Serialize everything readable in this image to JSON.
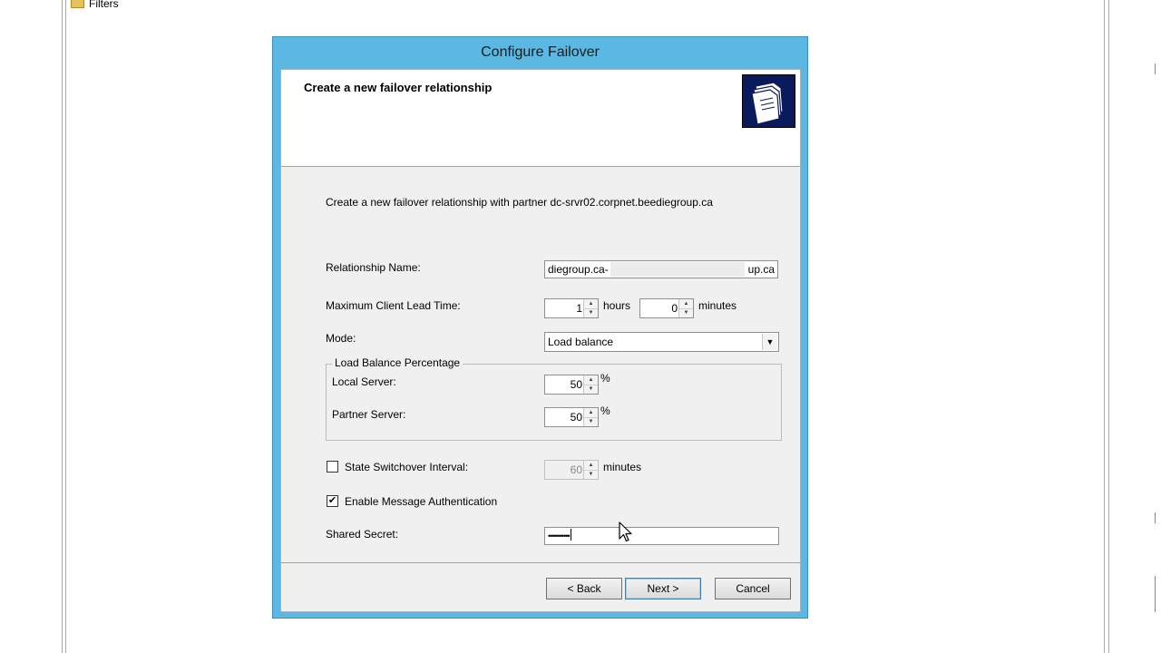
{
  "background": {
    "filters_label": "Filters"
  },
  "dialog": {
    "title": "Configure Failover",
    "header_title": "Create a new failover relationship",
    "intro_text": "Create a new failover relationship with partner dc-srvr02.corpnet.beediegroup.ca",
    "relationship_name": {
      "label": "Relationship Name:",
      "value_left": "diegroup.ca-",
      "value_right": "up.ca"
    },
    "max_client_lead_time": {
      "label": "Maximum Client Lead Time:",
      "hours_value": "1",
      "hours_unit": "hours",
      "minutes_value": "0",
      "minutes_unit": "minutes"
    },
    "mode": {
      "label": "Mode:",
      "selected": "Load balance"
    },
    "load_balance": {
      "legend": "Load Balance Percentage",
      "local_label": "Local Server:",
      "local_value": "50",
      "partner_label": "Partner Server:",
      "partner_value": "50",
      "percent": "%"
    },
    "state_switchover": {
      "label": "State Switchover Interval:",
      "checked": false,
      "value": "60",
      "unit": "minutes"
    },
    "message_auth": {
      "label": "Enable Message Authentication",
      "checked": true,
      "check_glyph": "✔"
    },
    "shared_secret": {
      "label": "Shared Secret:",
      "value": "•••••••••••"
    },
    "buttons": {
      "back": "< Back",
      "next": "Next >",
      "cancel": "Cancel"
    }
  },
  "icons": {
    "wizard": "folders-icon",
    "spin_up": "▲",
    "spin_down": "▼",
    "dropdown": "▼"
  }
}
